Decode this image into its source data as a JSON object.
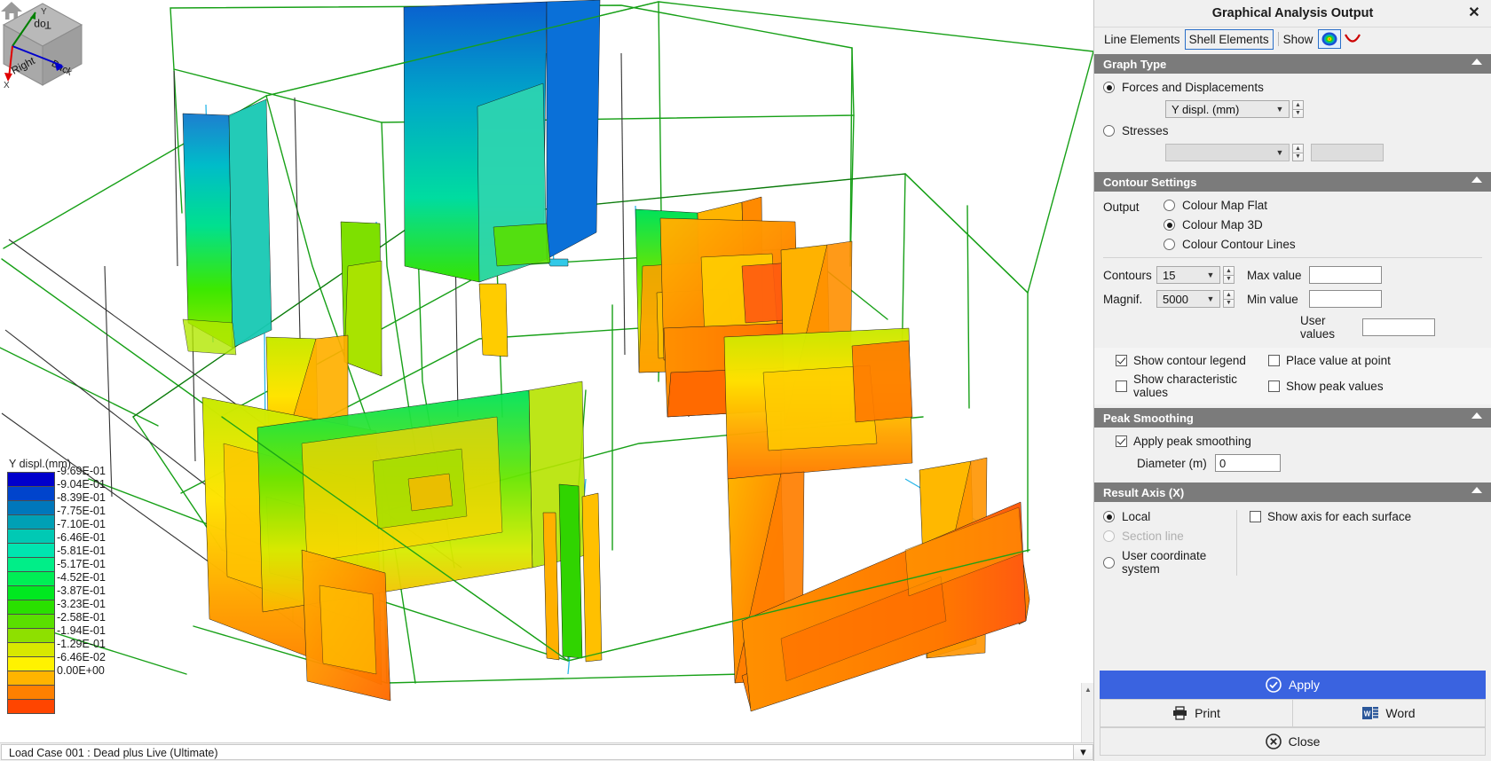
{
  "window": {
    "title": "Graphical Analysis Output",
    "close_label": "✕"
  },
  "tabs": {
    "line_elements": "Line Elements",
    "shell_elements": "Shell Elements",
    "show_label": "Show",
    "icon_contour": "contour-map-icon",
    "icon_deflection": "deflection-curve-icon"
  },
  "graph_type": {
    "section_title": "Graph Type",
    "forces_radio": "Forces and Displacements",
    "forces_value": "Y displ. (mm)",
    "stresses_radio": "Stresses",
    "stresses_value": ""
  },
  "contour_settings": {
    "section_title": "Contour Settings",
    "output_label": "Output",
    "opt_flat": "Colour Map Flat",
    "opt_3d": "Colour Map 3D",
    "opt_lines": "Colour Contour Lines",
    "contours_label": "Contours",
    "contours_value": "15",
    "magnif_label": "Magnif.",
    "magnif_value": "5000",
    "max_label": "Max value",
    "max_value": "",
    "min_label": "Min value",
    "min_value": "",
    "user_label": "User values",
    "user_value": "",
    "chk_legend": "Show contour legend",
    "chk_characteristic": "Show characteristic values",
    "chk_place_point": "Place value at point",
    "chk_peak_values": "Show peak values"
  },
  "peak_smoothing": {
    "section_title": "Peak Smoothing",
    "apply_label": "Apply peak smoothing",
    "diameter_label": "Diameter (m)",
    "diameter_value": "0"
  },
  "result_axis": {
    "section_title": "Result Axis (X)",
    "local": "Local",
    "section_line": "Section line",
    "user_cs": "User coordinate system",
    "show_axis": "Show axis for each surface"
  },
  "actions": {
    "apply": "Apply",
    "print": "Print",
    "word": "Word",
    "close": "Close",
    "apply_icon": "check-circle-icon",
    "print_icon": "printer-icon",
    "word_icon": "word-document-icon",
    "close_icon": "x-circle-icon"
  },
  "viewcube": {
    "top": "Top",
    "right": "Right",
    "back": "Back",
    "home_icon": "home-icon"
  },
  "axis_triad": {
    "x": "X",
    "y": "Y"
  },
  "statusbar": {
    "text": "Load Case 001 : Dead plus Live (Ultimate)"
  },
  "chart_data": {
    "type": "heatmap",
    "title": "Y displ.(mm)",
    "legend_title": "Y displ.(mm)",
    "legend_position": "left",
    "units": "mm",
    "description": "3D shell-element colour map contour of Y displacement on a building frame model",
    "bands": [
      {
        "label": "-9.69E-01",
        "value": -0.969,
        "color": "#0000cc"
      },
      {
        "label": "-9.04E-01",
        "value": -0.904,
        "color": "#0044cc"
      },
      {
        "label": "-8.39E-01",
        "value": -0.839,
        "color": "#0077bb"
      },
      {
        "label": "-7.75E-01",
        "value": -0.775,
        "color": "#00a0b5"
      },
      {
        "label": "-7.10E-01",
        "value": -0.71,
        "color": "#00c9b4"
      },
      {
        "label": "-6.46E-01",
        "value": -0.646,
        "color": "#00e5b0"
      },
      {
        "label": "-5.81E-01",
        "value": -0.581,
        "color": "#00ee88"
      },
      {
        "label": "-5.17E-01",
        "value": -0.517,
        "color": "#00ee55"
      },
      {
        "label": "-4.52E-01",
        "value": -0.452,
        "color": "#00e820"
      },
      {
        "label": "-3.87E-01",
        "value": -0.387,
        "color": "#2ae000"
      },
      {
        "label": "-3.23E-01",
        "value": -0.323,
        "color": "#5ae000"
      },
      {
        "label": "-2.58E-01",
        "value": -0.258,
        "color": "#8ee000"
      },
      {
        "label": "-1.94E-01",
        "value": -0.194,
        "color": "#d8e800"
      },
      {
        "label": "-1.29E-01",
        "value": -0.129,
        "color": "#fff200"
      },
      {
        "label": "-6.46E-02",
        "value": -0.0646,
        "color": "#ffb400"
      },
      {
        "label": "0.00E+00",
        "value": 0.0,
        "color": "#ff8000"
      }
    ],
    "last_swatch_color": "#ff4500",
    "min": -0.969,
    "max": 0.0,
    "n_contours": 15,
    "magnification": 5000
  }
}
